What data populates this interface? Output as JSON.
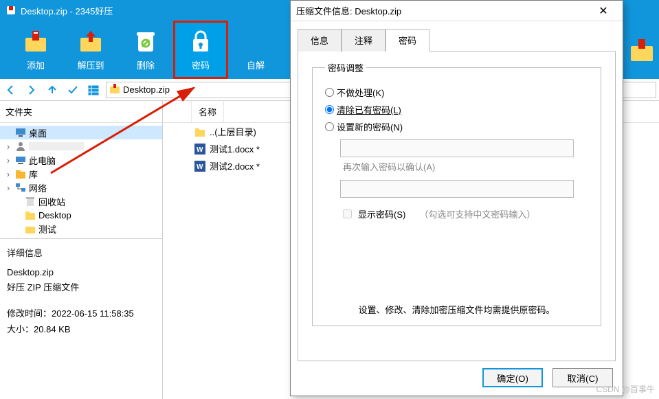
{
  "window": {
    "title": "Desktop.zip - 2345好压"
  },
  "toolbar": {
    "add": "添加",
    "extract": "解压到",
    "delete": "删除",
    "password": "密码",
    "self": "自解"
  },
  "nav": {
    "archive_name": "Desktop.zip"
  },
  "sidebar": {
    "header": "文件夹",
    "items": [
      {
        "label": "桌面",
        "icon": "desktop"
      },
      {
        "label": "",
        "icon": "user"
      },
      {
        "label": "此电脑",
        "icon": "pc"
      },
      {
        "label": "库",
        "icon": "lib"
      },
      {
        "label": "网络",
        "icon": "net"
      },
      {
        "label": "回收站",
        "icon": "recycle"
      },
      {
        "label": "Desktop",
        "icon": "folder"
      },
      {
        "label": "测试",
        "icon": "folder"
      }
    ]
  },
  "detail": {
    "header": "详细信息",
    "file": "Desktop.zip",
    "type": "好压 ZIP 压缩文件",
    "mtime_label": "修改时间：",
    "mtime": "2022-06-15 11:58:35",
    "size_label": "大小：",
    "size": "20.84 KB"
  },
  "filelist": {
    "col_name": "名称",
    "rows": [
      {
        "label": "..(上层目录)",
        "icon": "folder"
      },
      {
        "label": "测试1.docx *",
        "icon": "word"
      },
      {
        "label": "测试2.docx *",
        "icon": "word"
      }
    ]
  },
  "dialog": {
    "title": "压缩文件信息: Desktop.zip",
    "tabs": {
      "info": "信息",
      "comment": "注释",
      "password": "密码"
    },
    "fieldset_legend": "密码调整",
    "radio_keep": "不做处理(K)",
    "radio_clear": "清除已有密码(L)",
    "radio_set": "设置新的密码(N)",
    "confirm_hint": "再次输入密码以确认(A)",
    "show_pw": "显示密码(S)",
    "cn_hint": "（勾选可支持中文密码输入）",
    "footer_msg": "设置、修改、清除加密压缩文件均需提供原密码。",
    "ok": "确定(O)",
    "cancel": "取消(C)"
  },
  "watermark": "CSDN @百事牛"
}
